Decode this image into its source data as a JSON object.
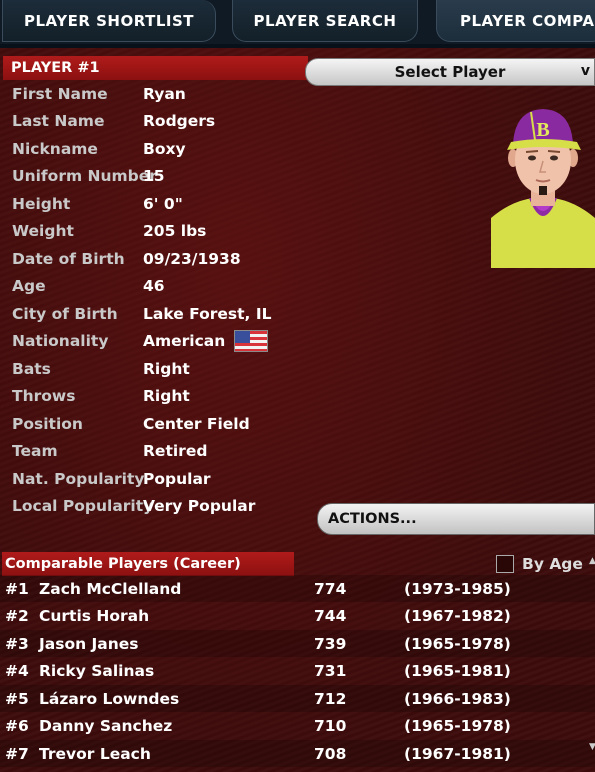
{
  "tabs": [
    {
      "label": "PLAYER SHORTLIST"
    },
    {
      "label": "PLAYER SEARCH"
    },
    {
      "label": "PLAYER COMPARISON",
      "visible_label": "PLAYER COMPAR"
    }
  ],
  "player": {
    "header": "PLAYER #1",
    "select_label": "Select Player",
    "fields": [
      {
        "label": "First Name",
        "value": "Ryan"
      },
      {
        "label": "Last Name",
        "value": "Rodgers"
      },
      {
        "label": "Nickname",
        "value": "Boxy"
      },
      {
        "label": "Uniform Number",
        "value": "15"
      },
      {
        "label": "Height",
        "value": "6' 0\""
      },
      {
        "label": "Weight",
        "value": "205 lbs"
      },
      {
        "label": "Date of Birth",
        "value": "09/23/1938"
      },
      {
        "label": "Age",
        "value": "46"
      },
      {
        "label": "City of Birth",
        "value": "Lake Forest, IL"
      },
      {
        "label": "Nationality",
        "value": "American"
      },
      {
        "label": "Bats",
        "value": "Right"
      },
      {
        "label": "Throws",
        "value": "Right"
      },
      {
        "label": "Position",
        "value": "Center Field"
      },
      {
        "label": "Team",
        "value": "Retired"
      },
      {
        "label": "Nat. Popularity",
        "value": "Popular"
      },
      {
        "label": "Local Popularity",
        "value": "Very Popular"
      }
    ],
    "nationality_flag": "us-flag-icon",
    "cap_letter": "B",
    "actions_label": "ACTIONS..."
  },
  "comparable": {
    "header": "Comparable Players (Career)",
    "by_age_label": "By Age",
    "by_age_checked": false,
    "rows": [
      {
        "rank": "#1",
        "name": "Zach McClelland",
        "score": "774",
        "years": "(1973-1985)"
      },
      {
        "rank": "#2",
        "name": "Curtis Horah",
        "score": "744",
        "years": "(1967-1982)"
      },
      {
        "rank": "#3",
        "name": "Jason Janes",
        "score": "739",
        "years": "(1965-1978)"
      },
      {
        "rank": "#4",
        "name": "Ricky Salinas",
        "score": "731",
        "years": "(1965-1981)"
      },
      {
        "rank": "#5",
        "name": "Lázaro Lowndes",
        "score": "712",
        "years": "(1966-1983)"
      },
      {
        "rank": "#6",
        "name": "Danny Sanchez",
        "score": "710",
        "years": "(1965-1978)"
      },
      {
        "rank": "#7",
        "name": "Trevor Leach",
        "score": "708",
        "years": "(1967-1981)"
      }
    ]
  },
  "colors": {
    "header_red": "#a51616",
    "panel_bg": "#3d0b0b",
    "tab_bg": "#1a2836",
    "jersey": "#d8e04a",
    "cap": "#8a2aa0"
  }
}
